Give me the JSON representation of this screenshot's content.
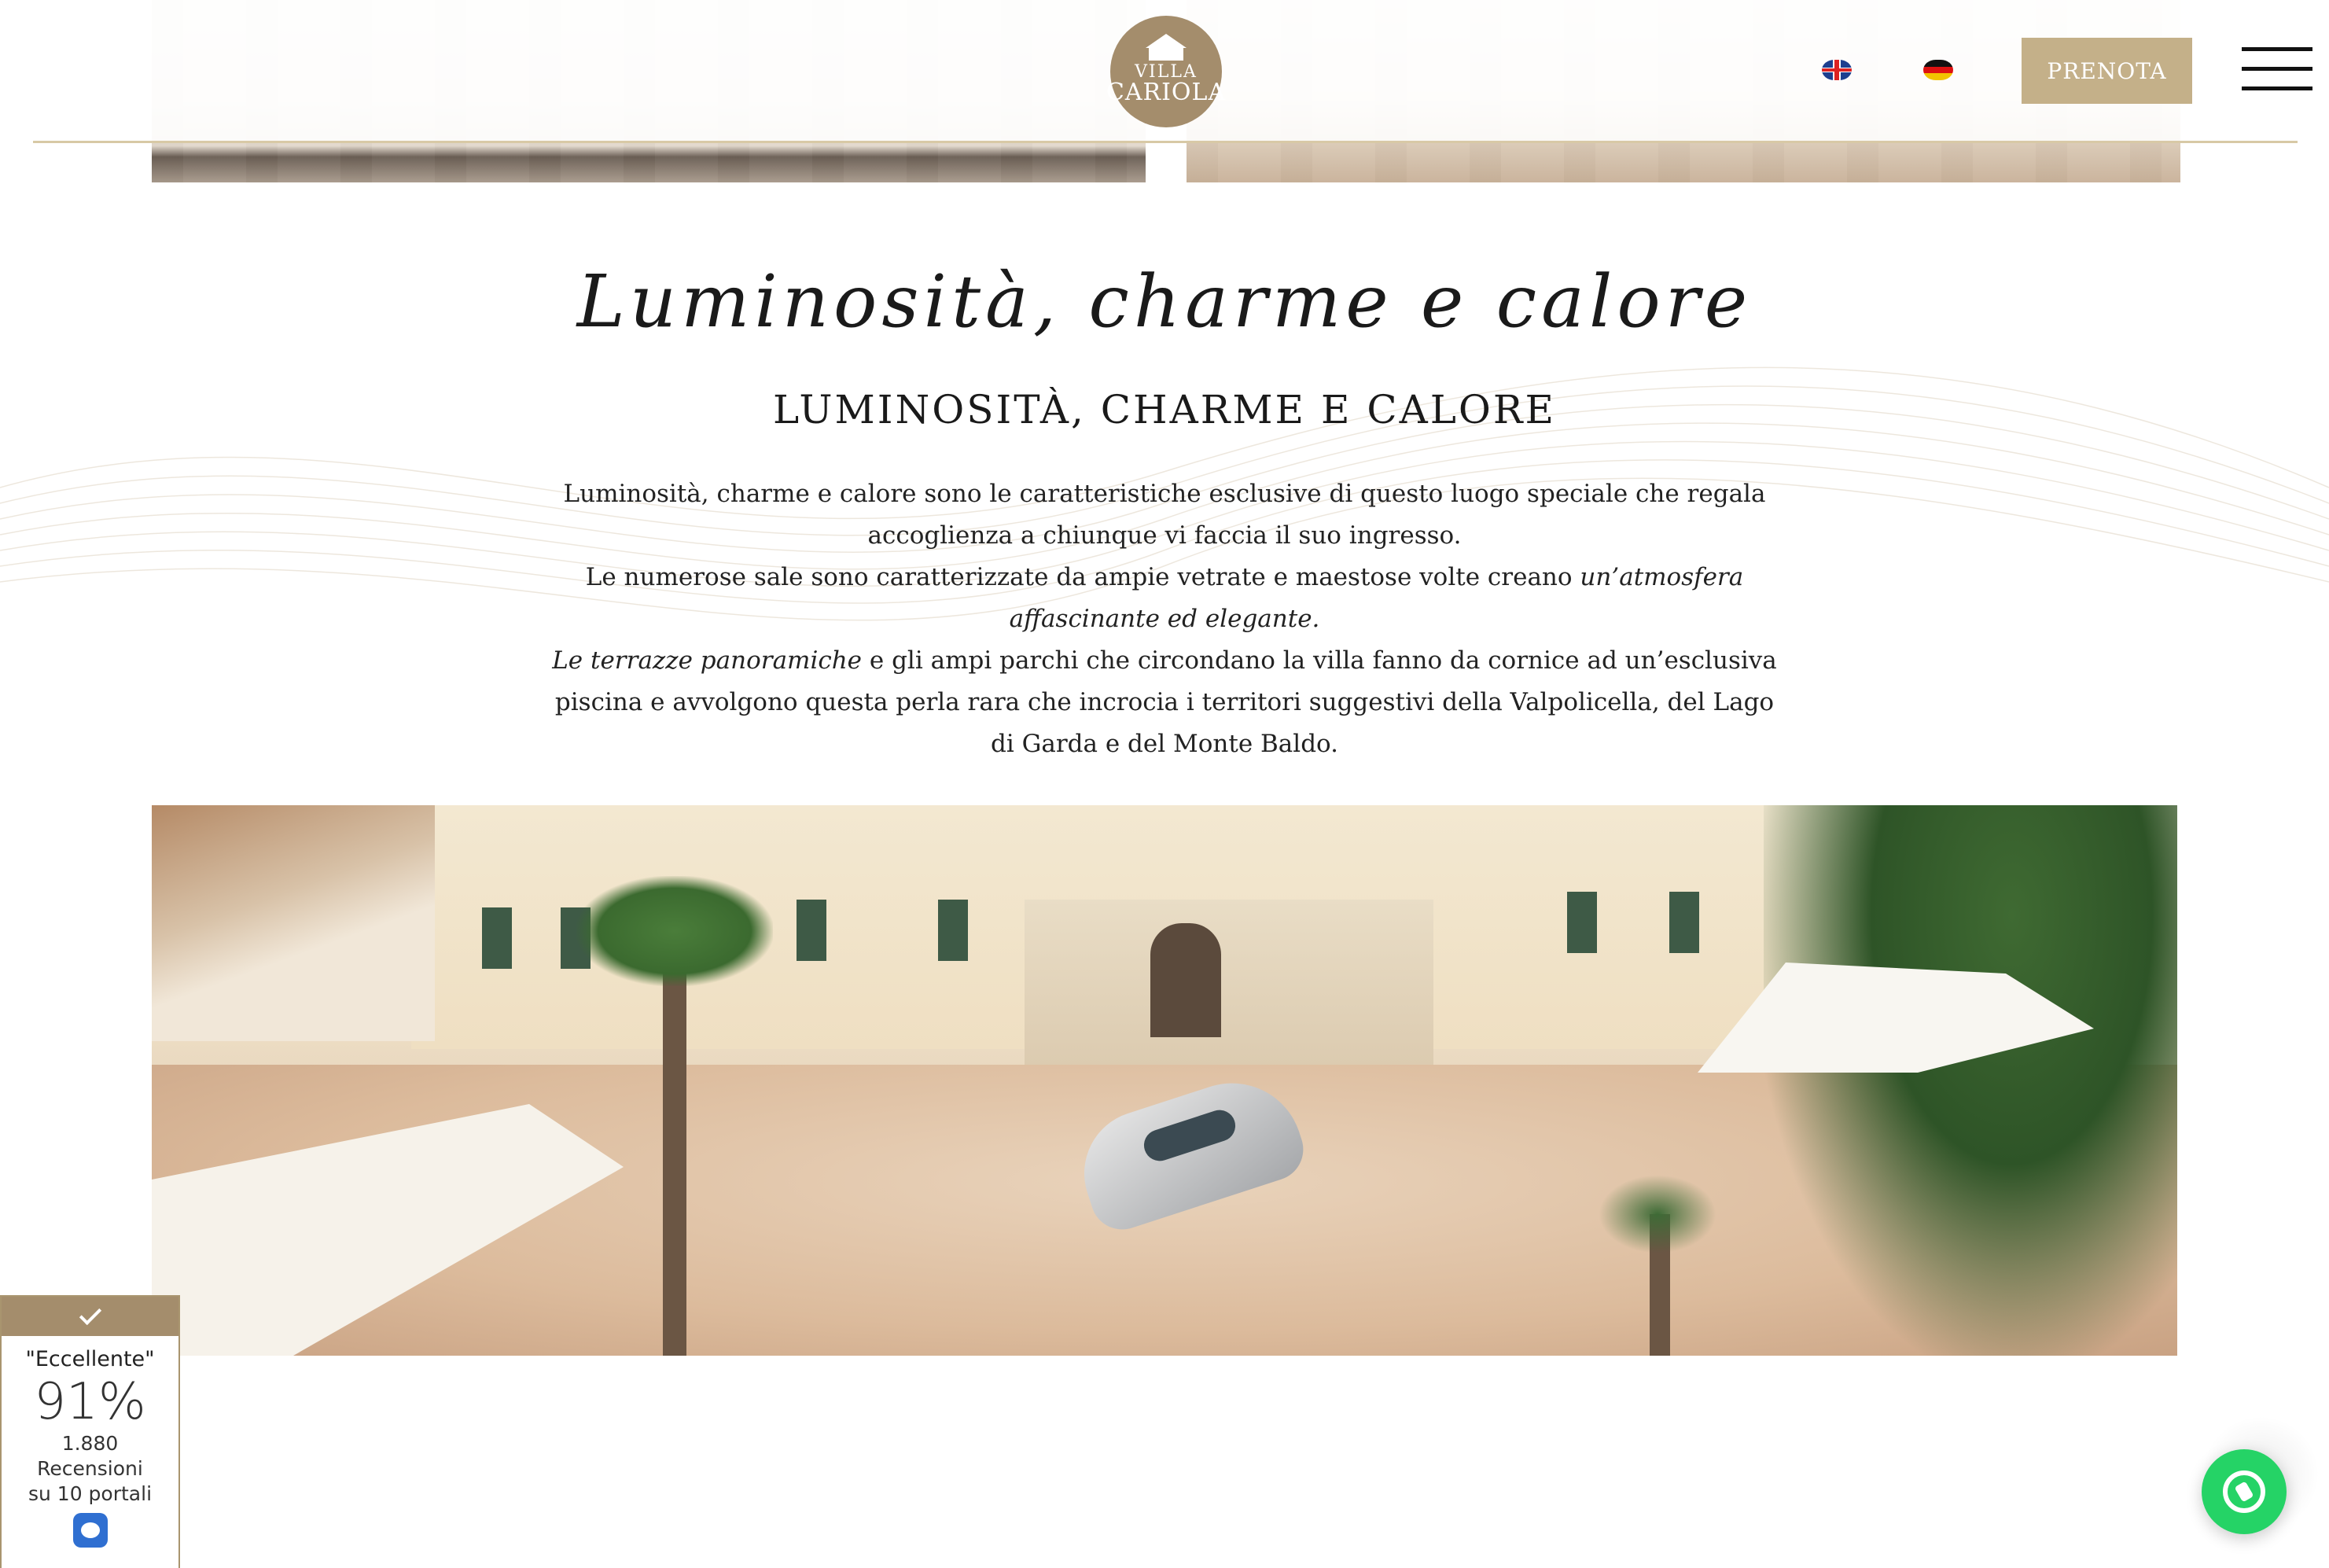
{
  "header": {
    "logo_line1": "VILLA",
    "logo_line2": "CARIOLA",
    "languages": [
      {
        "code": "en",
        "icon": "uk-flag-icon"
      },
      {
        "code": "de",
        "icon": "germany-flag-icon"
      }
    ],
    "book_label": "PRENOTA",
    "menu_icon": "hamburger-menu-icon",
    "accent_color": "#c4b089"
  },
  "section": {
    "script_title": "Luminosità, charme e calore",
    "title": "LUMINOSITÀ, CHARME E CALORE",
    "p1": "Luminosità, charme e calore sono le caratteristiche esclusive di questo luogo speciale che regala accoglienza a chiunque vi faccia il suo ingresso.",
    "p2_plain": "Le numerose sale sono caratterizzate da ampie vetrate e maestose volte creano ",
    "p2_em": "un’atmosfera affascinante ed elegante.",
    "p3_em": "Le terrazze panoramiche",
    "p3_plain": " e gli ampi parchi che circondano la villa fanno da cornice ad un’esclusiva piscina e avvolgono questa perla rara che incrocia i territori suggestivi della Valpolicella, del Lago di Garda e del Monte Baldo."
  },
  "review_badge": {
    "label": "\"Eccellente\"",
    "score": "91%",
    "count": "1.880",
    "line1": "Recensioni",
    "line2": "su 10 portali",
    "icon": "review-chat-icon"
  },
  "whatsapp": {
    "icon": "whatsapp-icon",
    "color": "#25d366"
  }
}
